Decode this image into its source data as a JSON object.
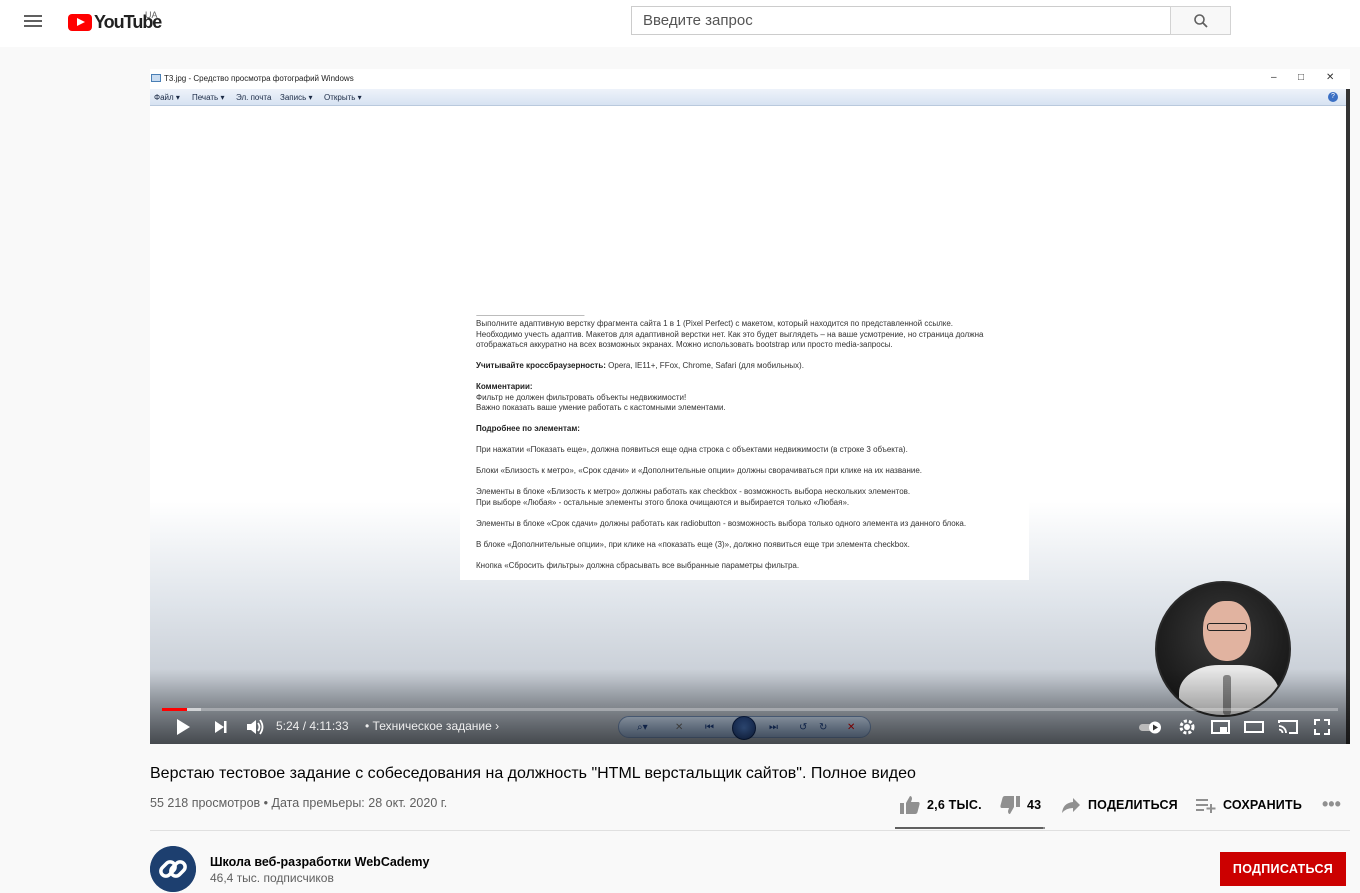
{
  "masthead": {
    "logo_text": "YouTube",
    "country_code": "UA",
    "search_placeholder": "Введите запрос"
  },
  "photo_viewer": {
    "window_title": "T3.jpg - Средство просмотра фотографий Windows",
    "menu": [
      "Файл",
      "Печать",
      "Эл. почта",
      "Запись",
      "Открыть"
    ],
    "help_label": "?",
    "document": {
      "separator": "------------------------------------------------------------------------------------------------------------",
      "intro": [
        "Выполните адаптивную верстку фрагмента сайта 1 в 1 (Pixel Perfect) с макетом, который находится по представленной ссылке.",
        "Необходимо учесть адаптив. Макетов для адаптивной верстки нет. Как это будет выглядеть – на ваше усмотрение, но страница должна",
        "отображаться аккуратно на всех возможных экранах. Можно использовать bootstrap или просто media-запросы."
      ],
      "crossbrowser_label": "Учитывайте кроссбраузерность:",
      "crossbrowser_text": " Opera, IE11+, FFox, Chrome, Safari (для мобильных).",
      "comments_heading": "Комментарии:",
      "comments": [
        "Фильтр не должен фильтровать объекты недвижимости!",
        "Важно показать ваше умение работать с кастомными элементами."
      ],
      "details_heading": "Подробнее по элементам:",
      "details": [
        "При нажатии «Показать еще», должна появиться еще одна строка с объектами недвижимости (в строке 3 объекта).",
        "Блоки «Близость к метро», «Срок сдачи» и «Дополнительные опции» должны сворачиваться при клике на их название.",
        "Элементы в блоке «Близость к метро» должны работать как checkbox - возможность выбора нескольких элементов.",
        "При выборе «Любая» - остальные элементы этого блока очищаются и выбирается только «Любая».",
        "Элементы в блоке «Срок сдачи» должны работать как radiobutton - возможность выбора только одного элемента из данного блока.",
        "В блоке «Дополнительные опции», при клике на «показать еще (3)», должно появиться еще три элемента checkbox.",
        "Кнопка «Сбросить фильтры» должна сбрасывать все выбранные параметры фильтра."
      ]
    }
  },
  "player": {
    "current_time": "5:24",
    "duration": "4:11:33",
    "time_display": "5:24 / 4:11:33",
    "chapter": "Техническое задание",
    "progress_fraction": 0.021,
    "buffered_fraction": 0.033
  },
  "video": {
    "title": "Верстаю тестовое задание с собеседования на должность \"HTML верстальщик сайтов\". Полное видео",
    "info": "55 218 просмотров • Дата премьеры: 28 окт. 2020 г.",
    "likes": "2,6 ТЫС.",
    "dislikes": "43",
    "share_label": "ПОДЕЛИТЬСЯ",
    "save_label": "СОХРАНИТЬ",
    "like_fraction": 0.984
  },
  "channel": {
    "name": "Школа веб-разработки WebCademy",
    "subscribers": "46,4 тыс. подписчиков",
    "subscribe_label": "ПОДПИСАТЬСЯ"
  },
  "colors": {
    "brand_red": "#ff0000",
    "subscribe_red": "#cc0000",
    "progress_red": "#ff0000"
  }
}
